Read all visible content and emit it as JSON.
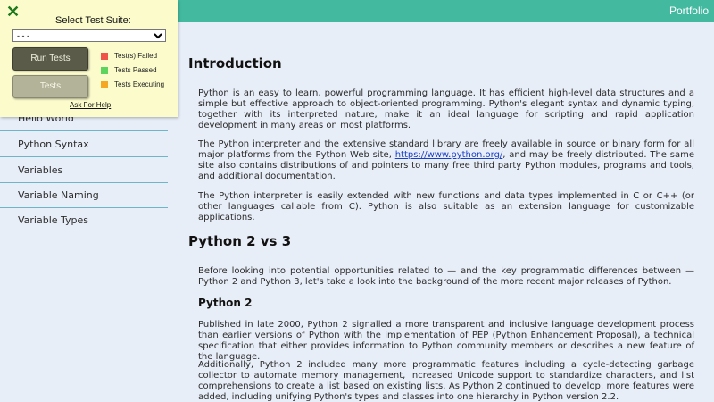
{
  "topbar": {
    "right_link": "Portfolio",
    "accent_color": "#43b9a0"
  },
  "sidebar": {
    "items": [
      {
        "label": "Hello World"
      },
      {
        "label": "Python Syntax"
      },
      {
        "label": "Variables"
      },
      {
        "label": "Variable Naming"
      },
      {
        "label": "Variable Types"
      }
    ]
  },
  "test_panel": {
    "close_icon": "x-mark-icon",
    "suite_label": "Select Test Suite:",
    "suite_selected": "- - -",
    "run_button": "Run Tests",
    "tests_button": "Tests",
    "legend": [
      {
        "label": "Test(s) Failed",
        "color": "#f0524a"
      },
      {
        "label": "Tests Passed",
        "color": "#5dd45d"
      },
      {
        "label": "Tests Executing",
        "color": "#f5a623"
      }
    ],
    "help_link": "Ask For Help"
  },
  "content": {
    "h_intro": "Introduction",
    "p1": "Python is an easy to learn, powerful programming language. It has efficient high-level data structures and a simple but effective approach to object-oriented programming. Python's elegant syntax and dynamic typing, together with its interpreted nature, make it an ideal language for scripting and rapid application development in many areas on most platforms.",
    "p2_before": "The Python interpreter and the extensive standard library are freely available in source or binary form for all major platforms from the Python Web site, ",
    "p2_link": "https://www.python.org/",
    "p2_after": ", and may be freely distributed. The same site also contains distributions of and pointers to many free third party Python modules, programs and tools, and additional documentation.",
    "p3": "The Python interpreter is easily extended with new functions and data types implemented in C or C++ (or other languages callable from C). Python is also suitable as an extension language for customizable applications.",
    "h_vs": "Python 2 vs 3",
    "p4": "Before looking into potential opportunities related to — and the key programmatic differences between — Python 2 and Python 3, let's take a look into the background of the more recent major releases of Python.",
    "h_py2": "Python 2",
    "p5": "Published in late 2000, Python 2 signalled a more transparent and inclusive language development process than earlier versions of Python with the implementation of PEP (Python Enhancement Proposal), a technical specification that either provides information to Python community members or describes a new feature of the language.",
    "p6": "Additionally, Python 2 included many more programmatic features including a cycle-detecting garbage collector to automate memory management, increased Unicode support to standardize characters, and list comprehensions to create a list based on existing lists. As Python 2 continued to develop, more features were added, including unifying Python's types and classes into one hierarchy in Python version 2.2."
  }
}
